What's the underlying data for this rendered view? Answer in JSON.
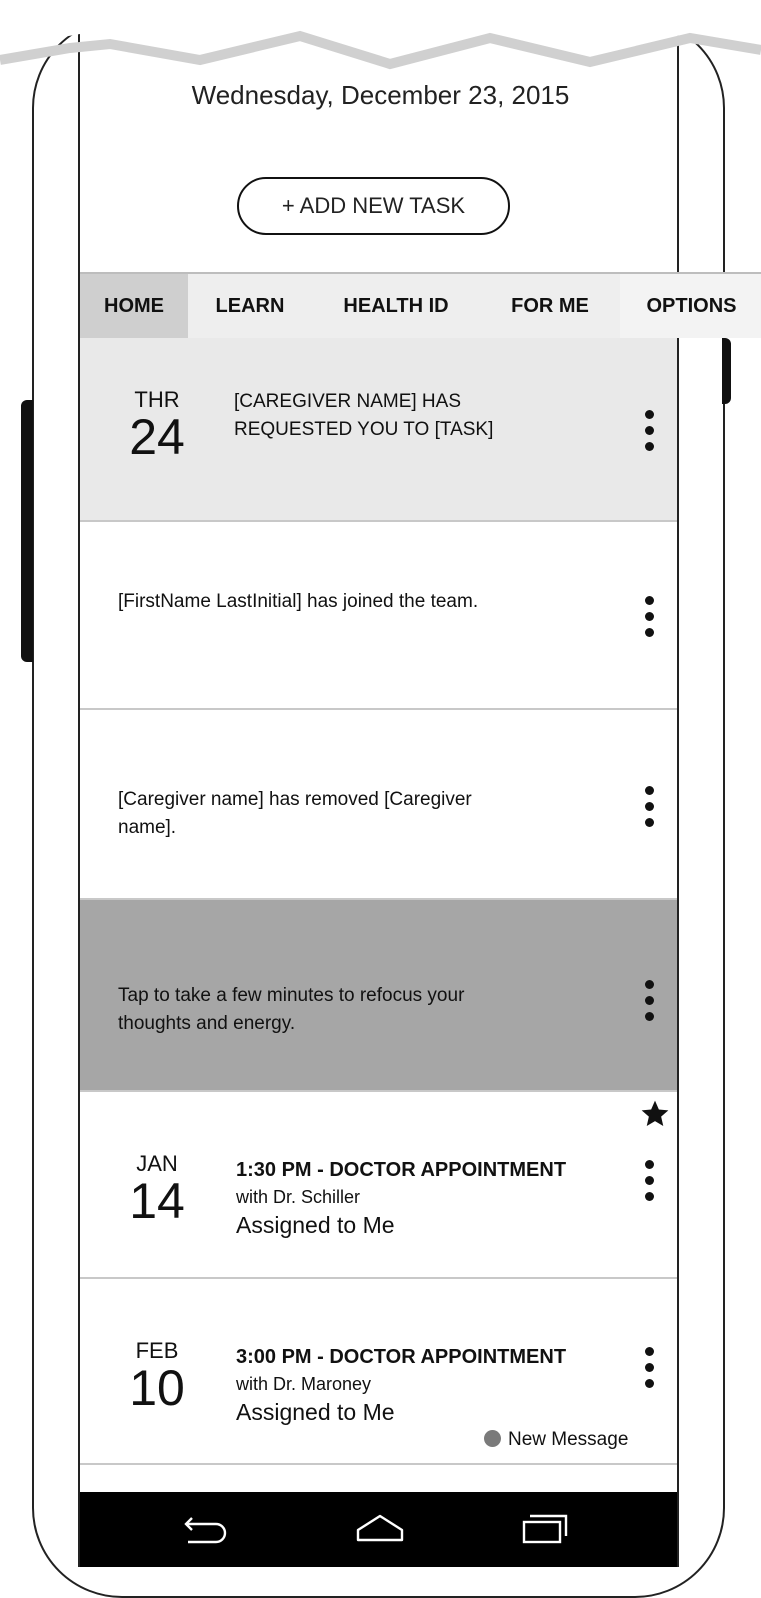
{
  "header": {
    "date": "Wednesday, December 23, 2015",
    "add_task_label": "+ ADD NEW TASK"
  },
  "tabs": [
    {
      "label": "HOME",
      "active": true
    },
    {
      "label": "LEARN",
      "active": false
    },
    {
      "label": "HEALTH ID",
      "active": false
    },
    {
      "label": "FOR ME",
      "active": false
    },
    {
      "label": "OPTIONS",
      "active": false
    }
  ],
  "feed": {
    "request": {
      "month": "THR",
      "day": "24",
      "text": "[CAREGIVER NAME] HAS REQUESTED YOU TO [TASK]"
    },
    "joined": {
      "text": "[FirstName LastInitial] has joined the team."
    },
    "removed": {
      "text": "[Caregiver name] has removed [Caregiver name]."
    },
    "refocus": {
      "text": "Tap to take a few minutes to refocus your thoughts and energy."
    },
    "appointments": [
      {
        "month": "JAN",
        "day": "14",
        "title": "1:30 PM - DOCTOR APPOINTMENT",
        "with": "with Dr. Schiller",
        "assigned": "Assigned to Me",
        "starred": true
      },
      {
        "month": "FEB",
        "day": "10",
        "title": "3:00 PM - DOCTOR APPOINTMENT",
        "with": "with Dr. Maroney",
        "assigned": "Assigned to Me",
        "new_message_label": "New Message"
      }
    ]
  },
  "icons": {
    "kebab": "more-vert-icon",
    "star": "star-icon",
    "nav_back": "back-icon",
    "nav_home": "home-icon",
    "nav_recent": "recent-apps-icon"
  },
  "colors": {
    "request_bg": "#e9e9e9",
    "refocus_bg": "#a6a6a6",
    "tabbar_bg": "#eeeeee",
    "active_tab_bg": "#cfcfcf",
    "nav_bar_bg": "#000000",
    "new_message_dot": "#7a7a7a"
  }
}
